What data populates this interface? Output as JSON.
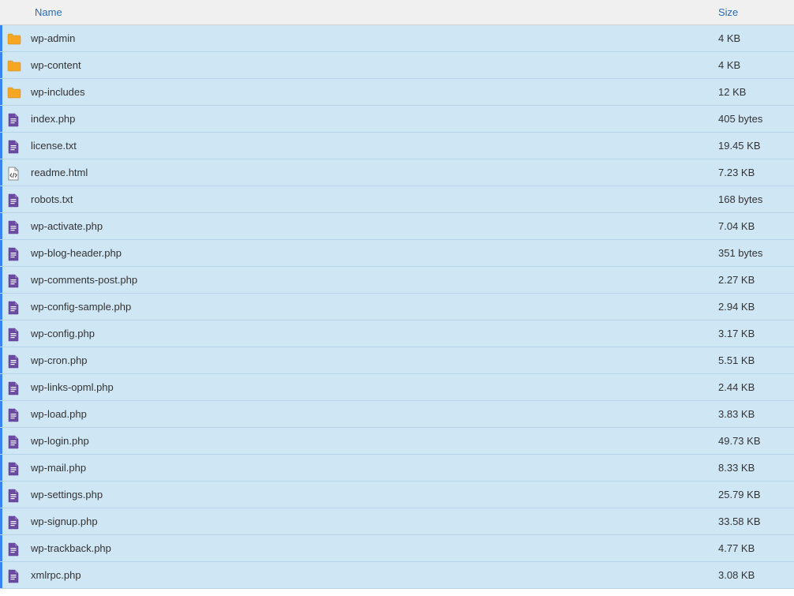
{
  "columns": {
    "name": "Name",
    "size": "Size"
  },
  "items": [
    {
      "icon": "folder",
      "name": "wp-admin",
      "size": "4 KB"
    },
    {
      "icon": "folder",
      "name": "wp-content",
      "size": "4 KB"
    },
    {
      "icon": "folder",
      "name": "wp-includes",
      "size": "12 KB"
    },
    {
      "icon": "file",
      "name": "index.php",
      "size": "405 bytes"
    },
    {
      "icon": "file",
      "name": "license.txt",
      "size": "19.45 KB"
    },
    {
      "icon": "html",
      "name": "readme.html",
      "size": "7.23 KB"
    },
    {
      "icon": "file",
      "name": "robots.txt",
      "size": "168 bytes"
    },
    {
      "icon": "file",
      "name": "wp-activate.php",
      "size": "7.04 KB"
    },
    {
      "icon": "file",
      "name": "wp-blog-header.php",
      "size": "351 bytes"
    },
    {
      "icon": "file",
      "name": "wp-comments-post.php",
      "size": "2.27 KB"
    },
    {
      "icon": "file",
      "name": "wp-config-sample.php",
      "size": "2.94 KB"
    },
    {
      "icon": "file",
      "name": "wp-config.php",
      "size": "3.17 KB"
    },
    {
      "icon": "file",
      "name": "wp-cron.php",
      "size": "5.51 KB"
    },
    {
      "icon": "file",
      "name": "wp-links-opml.php",
      "size": "2.44 KB"
    },
    {
      "icon": "file",
      "name": "wp-load.php",
      "size": "3.83 KB"
    },
    {
      "icon": "file",
      "name": "wp-login.php",
      "size": "49.73 KB"
    },
    {
      "icon": "file",
      "name": "wp-mail.php",
      "size": "8.33 KB"
    },
    {
      "icon": "file",
      "name": "wp-settings.php",
      "size": "25.79 KB"
    },
    {
      "icon": "file",
      "name": "wp-signup.php",
      "size": "33.58 KB"
    },
    {
      "icon": "file",
      "name": "wp-trackback.php",
      "size": "4.77 KB"
    },
    {
      "icon": "file",
      "name": "xmlrpc.php",
      "size": "3.08 KB"
    }
  ]
}
